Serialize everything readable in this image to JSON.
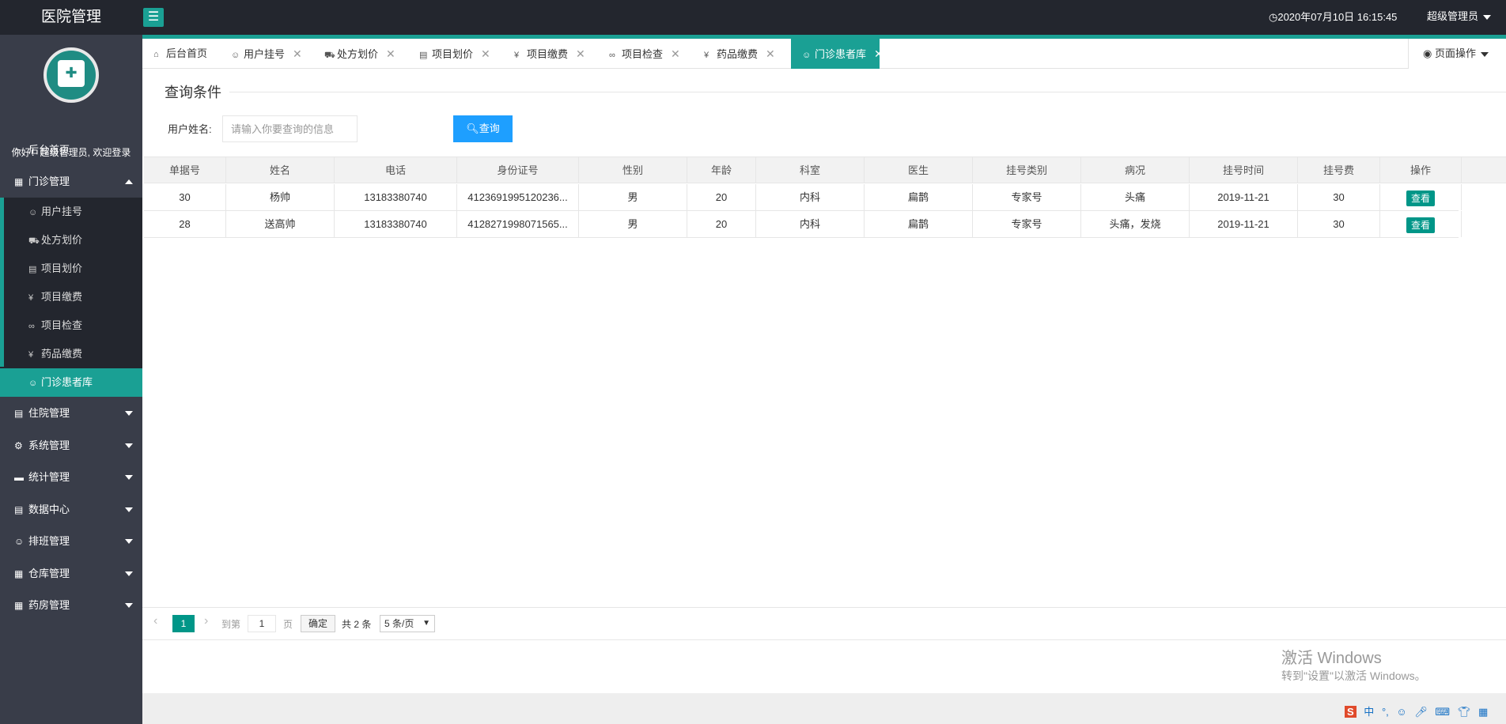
{
  "header": {
    "logo": "医院管理",
    "menu_toggle_icon": "☰",
    "datetime": "2020年07月10日 16:15:45",
    "user": "超级管理员"
  },
  "sidebar": {
    "welcome": "你好！超级管理员, 欢迎登录",
    "items": [
      {
        "label": "后台首页",
        "icon": "⌂"
      },
      {
        "label": "门诊管理",
        "icon": "▦"
      },
      {
        "label": "住院管理",
        "icon": "▤"
      },
      {
        "label": "系统管理",
        "icon": "⚙"
      },
      {
        "label": "统计管理",
        "icon": "▬"
      },
      {
        "label": "数据中心",
        "icon": "▤"
      },
      {
        "label": "排班管理",
        "icon": "☺"
      },
      {
        "label": "仓库管理",
        "icon": "▦"
      },
      {
        "label": "药房管理",
        "icon": "▦"
      }
    ],
    "sub_items": [
      {
        "label": "用户挂号",
        "icon": "☺"
      },
      {
        "label": "处方划价",
        "icon": "⛟"
      },
      {
        "label": "项目划价",
        "icon": "▤"
      },
      {
        "label": "项目缴费",
        "icon": "¥"
      },
      {
        "label": "项目检查",
        "icon": "∞"
      },
      {
        "label": "药品缴费",
        "icon": "¥"
      },
      {
        "label": "门诊患者库",
        "icon": "☺"
      }
    ]
  },
  "tabs": [
    {
      "label": "后台首页",
      "icon": "⌂"
    },
    {
      "label": "用户挂号",
      "icon": "☺"
    },
    {
      "label": "处方划价",
      "icon": "⛟"
    },
    {
      "label": "项目划价",
      "icon": "▤"
    },
    {
      "label": "项目缴费",
      "icon": "¥"
    },
    {
      "label": "项目检查",
      "icon": "∞"
    },
    {
      "label": "药品缴费",
      "icon": "¥"
    },
    {
      "label": "门诊患者库",
      "icon": "☺"
    }
  ],
  "page_ops": "页面操作",
  "query": {
    "legend": "查询条件",
    "label": "用户姓名:",
    "placeholder": "请输入你要查询的信息",
    "button": "查询"
  },
  "table": {
    "headers": [
      "单据号",
      "姓名",
      "电话",
      "身份证号",
      "性别",
      "年龄",
      "科室",
      "医生",
      "挂号类别",
      "病况",
      "挂号时间",
      "挂号费",
      "操作"
    ],
    "rows": [
      [
        "30",
        "杨帅",
        "13183380740",
        "4123691995120236...",
        "男",
        "20",
        "内科",
        "扁鹊",
        "专家号",
        "头痛",
        "2019-11-21",
        "30",
        "查看"
      ],
      [
        "28",
        "送高帅",
        "13183380740",
        "4128271998071565...",
        "男",
        "20",
        "内科",
        "扁鹊",
        "专家号",
        "头痛，发烧",
        "2019-11-21",
        "30",
        "查看"
      ]
    ]
  },
  "pager": {
    "current": "1",
    "goto": "到第",
    "page_input": "1",
    "page_unit": "页",
    "confirm": "确定",
    "total": "共 2 条",
    "per_page": "5 条/页"
  },
  "watermark": {
    "title": "激活 Windows",
    "subtitle": "转到\"设置\"以激活 Windows。"
  },
  "tray": {
    "ime": "S",
    "lang": "中"
  },
  "colors": {
    "header": "#23262e",
    "sidebar": "#393d49",
    "accent": "#1aa094",
    "button": "#1e9fff",
    "view": "#009688"
  }
}
